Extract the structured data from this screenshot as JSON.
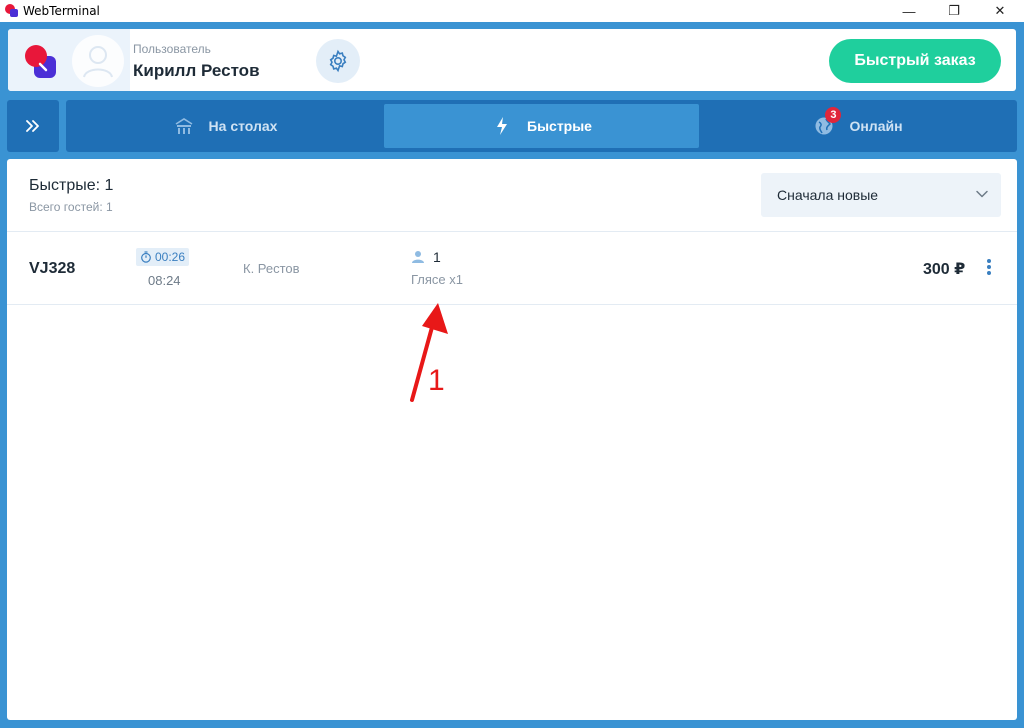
{
  "window": {
    "title": "WebTerminal",
    "minimize_glyph": "—",
    "maximize_glyph": "❐",
    "close_glyph": "✕"
  },
  "header": {
    "user_role": "Пользователь",
    "user_name": "Кирилл Рестов",
    "settings_icon": "gear-icon",
    "quick_order_label": "Быстрый заказ"
  },
  "colors": {
    "frame": "#3a93d3",
    "nav": "#1f6fb5",
    "tab_active": "#3a93d3",
    "quick_order": "#1fcf9d",
    "badge": "#e0263a",
    "annotation": "#e81818"
  },
  "nav": {
    "expand_icon": "double-chevron-right-icon",
    "tabs": [
      {
        "label": "На столах",
        "icon": "tables-icon",
        "active": false
      },
      {
        "label": "Быстрые",
        "icon": "lightning-icon",
        "active": true
      },
      {
        "label": "Онлайн",
        "icon": "globe-icon",
        "active": false,
        "badge": "3"
      }
    ]
  },
  "main": {
    "title": "Быстрые: 1",
    "guests_total": "Всего гостей: 1",
    "sort": {
      "selected": "Сначала новые"
    },
    "orders": [
      {
        "id": "VJ328",
        "timer": "00:26",
        "time": "08:24",
        "waiter": "К. Рестов",
        "guests": "1",
        "items": "Глясе x1",
        "price": "300 ₽"
      }
    ]
  },
  "annotation": {
    "label": "1"
  }
}
